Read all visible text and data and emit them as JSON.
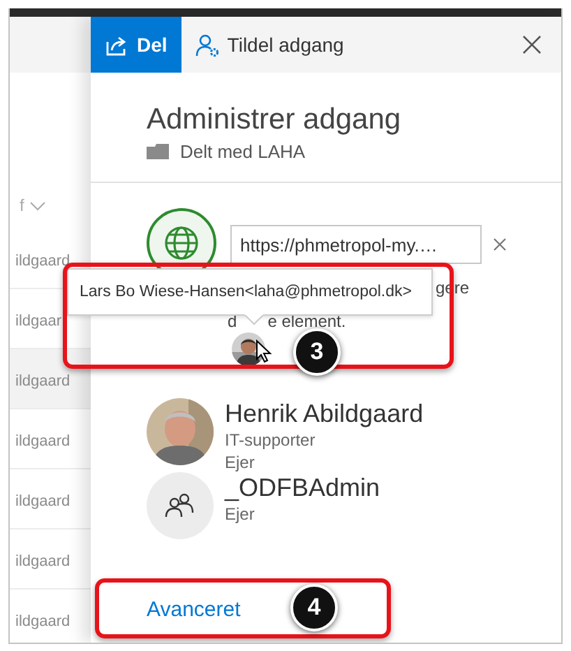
{
  "background_list": {
    "column_header": "f",
    "rows": [
      {
        "text": "ildgaard",
        "selected": false
      },
      {
        "text": "ildgaar",
        "selected": false
      },
      {
        "text": "ildgaard",
        "selected": true
      },
      {
        "text": "ildgaard",
        "selected": false
      },
      {
        "text": "ildgaard",
        "selected": false
      },
      {
        "text": "ildgaard",
        "selected": false
      },
      {
        "text": "ildgaard",
        "selected": false
      }
    ]
  },
  "panel": {
    "tabs": [
      {
        "label": "Del",
        "selected": true,
        "kind": "share"
      },
      {
        "label": "Tildel adgang",
        "selected": false,
        "kind": "grant"
      }
    ],
    "title": "Administrer adgang",
    "subtitle": "Delt med LAHA",
    "link": {
      "value": "https://phmetropol-my.…"
    },
    "description": {
      "line_1": "gere",
      "line_2_start": "d",
      "line_2_end": "e element."
    },
    "people": [
      {
        "name": "Henrik Abildgaard",
        "role": "IT-supporter",
        "permission": "Ejer"
      },
      {
        "kind": "group",
        "name": "_ODFBAdmin",
        "permission": "Ejer"
      }
    ],
    "advanced_link": "Avanceret"
  },
  "tooltip": "Lars Bo Wiese-Hansen<laha@phmetropol.dk>",
  "annotations": [
    {
      "number": "3",
      "kind": "tooltip"
    },
    {
      "number": "4",
      "kind": "advanced"
    }
  ]
}
